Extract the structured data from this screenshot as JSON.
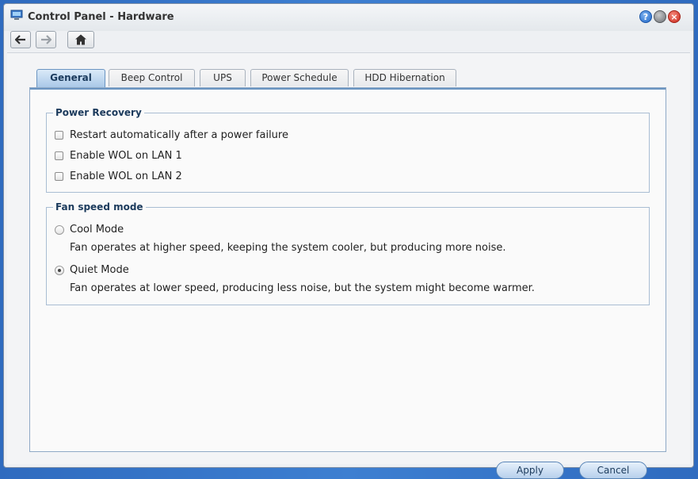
{
  "window": {
    "title": "Control Panel - Hardware",
    "icons": {
      "app": "hardware-monitor-icon",
      "help": "help-icon",
      "minimize": "minimize-icon",
      "close": "close-icon"
    }
  },
  "toolbar": {
    "back_icon": "arrow-left-icon",
    "forward_icon": "arrow-right-icon",
    "home_icon": "home-icon"
  },
  "tabs": [
    {
      "label": "General",
      "active": true
    },
    {
      "label": "Beep Control",
      "active": false
    },
    {
      "label": "UPS",
      "active": false
    },
    {
      "label": "Power Schedule",
      "active": false
    },
    {
      "label": "HDD Hibernation",
      "active": false
    }
  ],
  "power_recovery": {
    "legend": "Power Recovery",
    "options": [
      {
        "label": "Restart automatically after a power failure",
        "checked": false
      },
      {
        "label": "Enable WOL on LAN 1",
        "checked": false
      },
      {
        "label": "Enable WOL on LAN 2",
        "checked": false
      }
    ]
  },
  "fan_speed": {
    "legend": "Fan speed mode",
    "options": [
      {
        "label": "Cool Mode",
        "description": "Fan operates at higher speed, keeping the system cooler, but producing more noise.",
        "selected": false
      },
      {
        "label": "Quiet Mode",
        "description": "Fan operates at lower speed, producing less noise, but the system might become warmer.",
        "selected": true
      }
    ]
  },
  "buttons": {
    "apply": "Apply",
    "cancel": "Cancel"
  },
  "colors": {
    "accent": "#6b95c2",
    "desktop": "#3d7fd1",
    "heading": "#1b3a5c"
  }
}
